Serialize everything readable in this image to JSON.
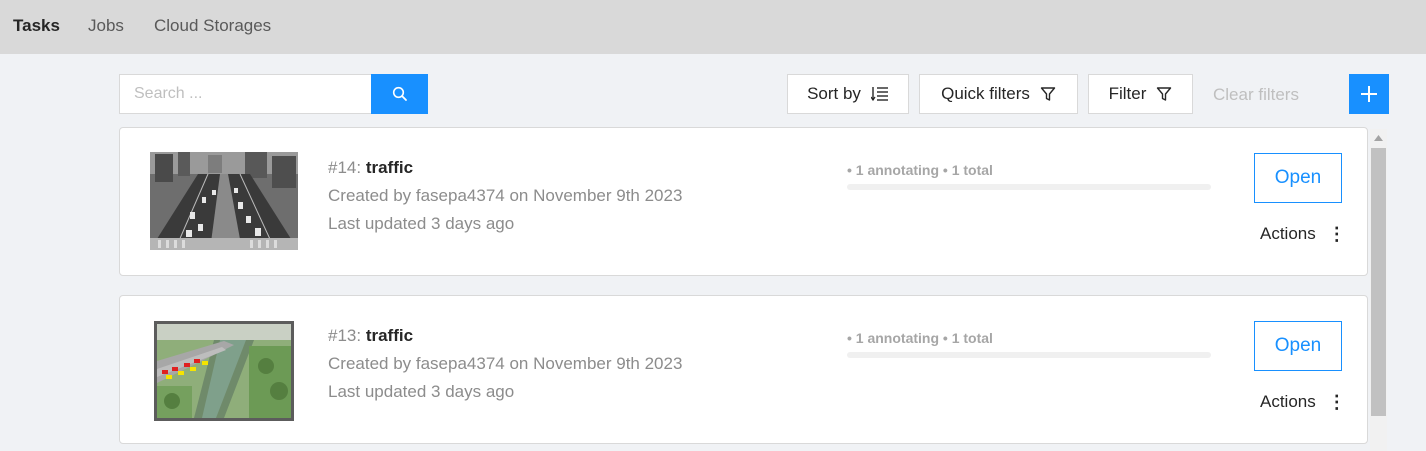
{
  "nav": {
    "tabs": [
      {
        "label": "Tasks",
        "active": true
      },
      {
        "label": "Jobs",
        "active": false
      },
      {
        "label": "Cloud Storages",
        "active": false
      }
    ]
  },
  "toolbar": {
    "search_placeholder": "Search ...",
    "search_value": "",
    "sort_by_label": "Sort by",
    "quick_filters_label": "Quick filters",
    "filter_label": "Filter",
    "clear_filters_label": "Clear filters",
    "add_icon": "plus-icon",
    "accent_color": "#1890ff"
  },
  "tasks": [
    {
      "id_label": "#14: ",
      "name": "traffic",
      "created": "Created by fasepa4374 on November 9th 2023",
      "updated": "Last updated 3 days ago",
      "progress_annotating": "• 1 annotating",
      "progress_total": "• 1 total",
      "progress_fraction": 0,
      "open_label": "Open",
      "actions_label": "Actions",
      "thumbnail": "grayscale-highway-photo"
    },
    {
      "id_label": "#13: ",
      "name": "traffic",
      "created": "Created by fasepa4374 on November 9th 2023",
      "updated": "Last updated 3 days ago",
      "progress_annotating": "• 1 annotating",
      "progress_total": "• 1 total",
      "progress_fraction": 0,
      "open_label": "Open",
      "actions_label": "Actions",
      "thumbnail": "aerial-river-road-photo"
    }
  ]
}
